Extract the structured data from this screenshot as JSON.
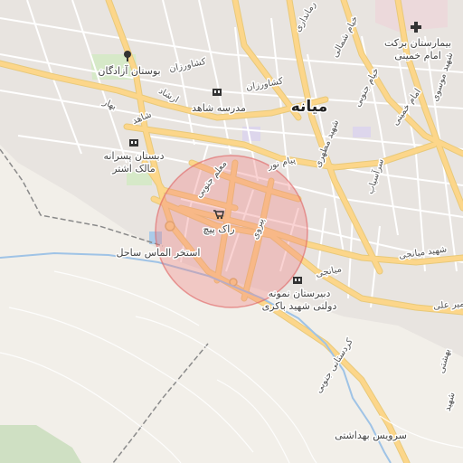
{
  "map": {
    "city_label": "میانه",
    "highlight_color": "#f08080",
    "pois": {
      "hospital": {
        "line1": "بیمارستان برکت",
        "line2": "امام خمینی",
        "icon": "hospital-icon"
      },
      "park": {
        "label": "بوستان آزادگان",
        "icon": "tree-icon"
      },
      "school_shahed": {
        "label": "مدرسه شاهد",
        "icon": "school-icon"
      },
      "school_malek": {
        "line1": "دبستان پسرانه",
        "line2": "مالک اشتر",
        "icon": "school-icon"
      },
      "shop": {
        "label": "راک پیچ",
        "icon": "shop-cart-icon"
      },
      "pool": {
        "label": "استخر الماس ساحل"
      },
      "highschool": {
        "line1": "دبیرستان نمونه",
        "line2": "دولتی شهید باکری",
        "icon": "school-icon"
      },
      "health": {
        "label": "سرویس بهداشتی"
      }
    },
    "streets": {
      "keshavarzan_1": "کشاورزان",
      "keshavarzan_2": "کشاورزان",
      "ershad": "ارشاد",
      "shahed": "شاهد",
      "bahar": "بهار",
      "khayyam_shomali": "خیام شمالی",
      "khayyam_jonubi": "خیام جنوبی",
      "emam_khomeini": "امام خمینی",
      "motahari": "شهید مطهری",
      "moallem_jonubi": "معلم جنوبی",
      "peyam_nur": "پیام نور",
      "sarasiyab": "سرآسیاب",
      "peyrowi": "پیروی",
      "miyanji_1": "شهید میانجی",
      "miyanji_2": "میانجی",
      "kordestani": "کردستانی جنوبی",
      "amir_ali": "امیر علی",
      "ramandi": "رمانداری",
      "mousavi": "شهید موسوی",
      "beheshti": "بهشتی",
      "shahid_b": "شهید"
    }
  }
}
